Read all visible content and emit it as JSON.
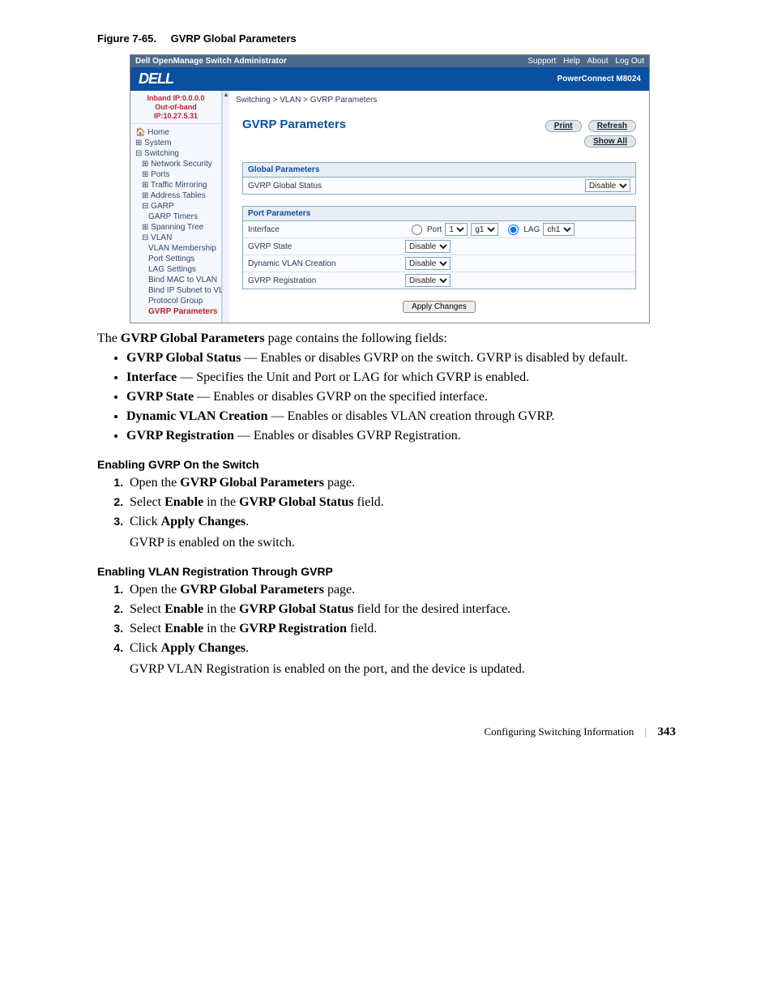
{
  "figure": {
    "number": "Figure 7-65.",
    "title": "GVRP Global Parameters"
  },
  "app": {
    "titlebar": {
      "title": "Dell OpenManage Switch Administrator",
      "links": [
        "Support",
        "Help",
        "About",
        "Log Out"
      ]
    },
    "brand": {
      "logo": "DELL",
      "product": "PowerConnect M8024"
    },
    "ip": {
      "line1": "Inband IP:0.0.0.0",
      "line2": "Out-of-band IP:10.27.5.31"
    },
    "nav": {
      "home": "Home",
      "system": "System",
      "switching": "Switching",
      "netsec": "Network Security",
      "ports": "Ports",
      "traffic": "Traffic Mirroring",
      "addr": "Address Tables",
      "garp": "GARP",
      "garptimers": "GARP Timers",
      "spanning": "Spanning Tree",
      "vlan": "VLAN",
      "vlanmember": "VLAN Membership",
      "portsettings": "Port Settings",
      "lagsettings": "LAG Settings",
      "bindmac": "Bind MAC to VLAN",
      "bindip": "Bind IP Subnet to VL",
      "protocol": "Protocol Group",
      "gvrp": "GVRP Parameters"
    },
    "crumb": "Switching > VLAN > GVRP Parameters",
    "pane": {
      "title": "GVRP Parameters",
      "buttons": {
        "print": "Print",
        "refresh": "Refresh",
        "showall": "Show All"
      },
      "global": {
        "header": "Global Parameters",
        "status_label": "GVRP Global Status",
        "status_value": "Disable"
      },
      "port": {
        "header": "Port Parameters",
        "interface_label": "Interface",
        "port_label": "Port",
        "port_unit": "1",
        "port_if": "g1",
        "lag_label": "LAG",
        "lag_value": "ch1",
        "state_label": "GVRP State",
        "state_value": "Disable",
        "dyn_label": "Dynamic VLAN Creation",
        "dyn_value": "Disable",
        "reg_label": "GVRP Registration",
        "reg_value": "Disable"
      },
      "apply": "Apply Changes"
    }
  },
  "intro": {
    "pre": "The ",
    "strong": "GVRP Global Parameters",
    "post": " page contains the following fields:"
  },
  "fields": [
    {
      "name": "GVRP Global Status",
      "desc": " — Enables or disables GVRP on the switch. GVRP is disabled by default."
    },
    {
      "name": "Interface",
      "desc": " — Specifies the Unit and Port or LAG for which GVRP is enabled."
    },
    {
      "name": "GVRP State",
      "desc": " — Enables or disables GVRP on the specified interface."
    },
    {
      "name": "Dynamic VLAN Creation",
      "desc": " — Enables or disables VLAN creation through GVRP."
    },
    {
      "name": "GVRP Registration",
      "desc": " — Enables or disables GVRP Registration."
    }
  ],
  "sec1": {
    "title": "Enabling GVRP On the Switch",
    "steps": {
      "s1a": "Open the ",
      "s1b": "GVRP Global Parameters",
      "s1c": " page.",
      "s2a": "Select ",
      "s2b": "Enable",
      "s2c": " in the ",
      "s2d": "GVRP Global Status",
      "s2e": " field.",
      "s3a": "Click ",
      "s3b": "Apply Changes",
      "s3c": ".",
      "s3r": "GVRP is enabled on the switch."
    }
  },
  "sec2": {
    "title": "Enabling VLAN Registration Through GVRP",
    "steps": {
      "s1a": "Open the ",
      "s1b": "GVRP Global Parameters",
      "s1c": " page.",
      "s2a": "Select ",
      "s2b": "Enable",
      "s2c": " in the ",
      "s2d": "GVRP Global Status",
      "s2e": " field for the desired interface.",
      "s3a": "Select ",
      "s3b": "Enable",
      "s3c": " in the ",
      "s3d": "GVRP Registration",
      "s3e": " field.",
      "s4a": "Click ",
      "s4b": "Apply Changes",
      "s4c": ".",
      "s4r": "GVRP VLAN Registration is enabled on the port, and the device is updated."
    }
  },
  "footer": {
    "section": "Configuring Switching Information",
    "page": "343"
  }
}
